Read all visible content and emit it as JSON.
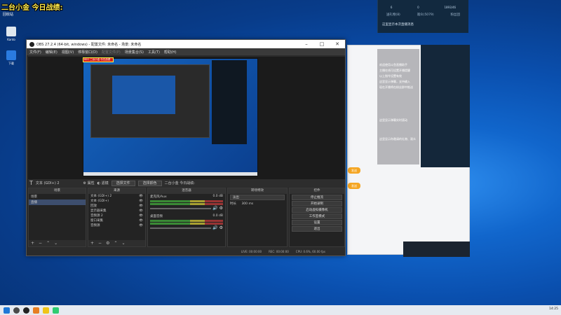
{
  "overlay": {
    "title": "二台小金 今日战绩:",
    "subtitle": "回收站"
  },
  "desktop_icons": [
    {
      "label": "Kanto",
      "icon": "app-icon"
    },
    {
      "label": "下载",
      "icon": "download-icon"
    }
  ],
  "live_panel": {
    "stats": [
      "6",
      "0",
      "1893/46"
    ],
    "tabs": [
      "送礼物(8)",
      "观众(5079)",
      "粉丝团"
    ],
    "notice": "这里显示本次直播消息"
  },
  "chat_overlay": {
    "lines": [
      "欢迎使用斗鱼直播助手",
      "主播在线可设置开播提醒",
      "以上指令设置有效",
      "这里显示弹幕，支持输入",
      "现在开播将在粉丝群中推送",
      "这里显示弹幕实时滚动",
      "这里显示你邀请的礼物、观众"
    ],
    "orange_buttons": [
      "发送",
      "发送"
    ]
  },
  "obs": {
    "title": "OBS 27.2.4 (64-bit, windows) - 配置文件: 未命名 - 场景: 未命名",
    "menu": [
      "文件(F)",
      "编辑(E)",
      "视图(V)",
      "停靠窗口(D)",
      "配置文件(P)",
      "场景集合(S)",
      "工具(T)",
      "帮助(H)"
    ],
    "menu_disabled": [
      4
    ],
    "rec_tag": "REC 二台小金 今日战绩",
    "scene_bar": {
      "source_label": "文本 (GDI+) 2",
      "props": "属性",
      "filters": "滤镜",
      "pick_file": "选择文件",
      "pick_color": "选择颜色",
      "text_value": "二台小金 今日战绩:"
    },
    "docks": {
      "scenes_title": "场景",
      "scenes": [
        "场景",
        "直播"
      ],
      "sources_title": "来源",
      "sources": [
        {
          "name": "文本 (GDI+) 2",
          "icon": "text-icon"
        },
        {
          "name": "文本 (GDI+)",
          "icon": "text-icon"
        },
        {
          "name": "回放",
          "icon": "replay-icon"
        },
        {
          "name": "显示器采集",
          "icon": "monitor-icon"
        },
        {
          "name": "音频源 2",
          "icon": "audio-icon"
        },
        {
          "name": "窗口采集",
          "icon": "window-icon"
        },
        {
          "name": "音频源",
          "icon": "audio-icon"
        }
      ],
      "mixer_title": "混音器",
      "mixer": [
        {
          "name": "麦克风/Aux",
          "db": "0.0 dB"
        },
        {
          "name": "桌面音频",
          "db": "0.0 dB"
        }
      ],
      "transitions_title": "转场特效",
      "transition_value": "淡出",
      "duration_label": "时长",
      "duration_value": "300 ms",
      "controls_title": "控件",
      "controls": [
        "停止推流",
        "开始录制",
        "启动虚拟摄像机",
        "工作室模式",
        "设置",
        "退出"
      ]
    },
    "status": {
      "live": "LIVE: 00:00:00",
      "rec": "REC: 00:00:00",
      "cpu": "CPU: 0.6%, 60.00 fps"
    }
  },
  "taskbar": {
    "time": "14:25"
  },
  "colors": {
    "obs_bg": "#2b2b2b",
    "accent_orange": "#f5a623",
    "rec_red": "#d81c1c"
  }
}
